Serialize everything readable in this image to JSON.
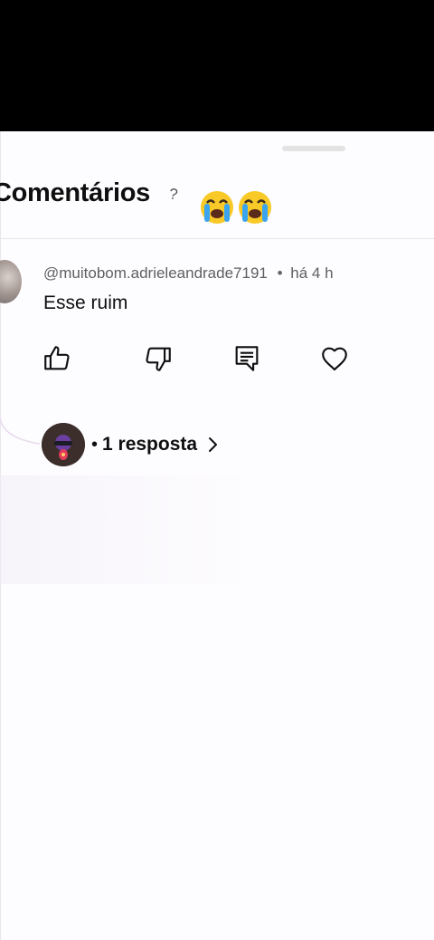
{
  "header": {
    "title": "Comentários",
    "help_symbol": "?",
    "emojis": [
      "crying-face",
      "crying-face"
    ]
  },
  "comment": {
    "author": "@muitobom.adrieleandrade7191",
    "separator": "•",
    "time": "há 4 h",
    "text": "Esse ruim",
    "actions": [
      "like",
      "dislike",
      "reply",
      "heart"
    ]
  },
  "replies": {
    "dot": "•",
    "label": "1 resposta"
  },
  "colors": {
    "sheet_background": "#fdfcfe",
    "text_primary": "#0f0f0f",
    "text_secondary": "#606060",
    "emoji_yellow": "#f9c928",
    "emoji_tears": "#3aa4f0"
  }
}
